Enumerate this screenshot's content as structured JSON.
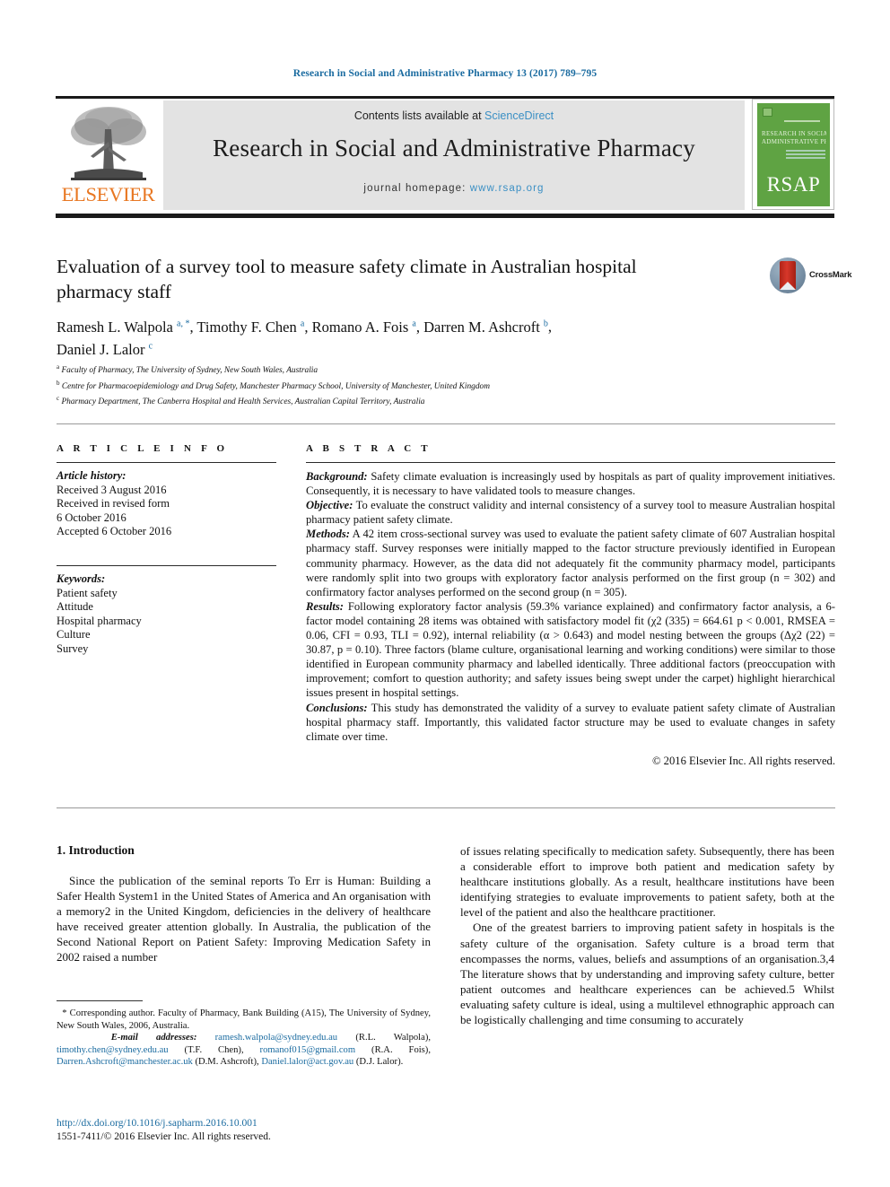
{
  "running_head": "Research in Social and Administrative Pharmacy 13 (2017) 789–795",
  "banner": {
    "contents_prefix": "Contents lists available at ",
    "sciencedirect": "ScienceDirect",
    "journal_title": "Research in Social and Administrative Pharmacy",
    "homepage_prefix": "journal homepage: ",
    "homepage_url": "www.rsap.org",
    "publisher": "ELSEVIER",
    "cover": {
      "line1": "RESEARCH IN SOCIAL &",
      "line2": "ADMINISTRATIVE PHARMACY",
      "acronym": "RSAP"
    },
    "colors": {
      "link": "#3a8fc4",
      "banner_bg": "#e3e3e3",
      "elsevier_orange": "#e87722",
      "cover_green": "#5fa343"
    }
  },
  "crossmark": {
    "label": "CrossMark"
  },
  "article": {
    "title": "Evaluation of a survey tool to measure safety climate in Australian hospital pharmacy staff",
    "authors_line1_parts": [
      {
        "name": "Ramesh L. Walpola ",
        "marks": "a, *"
      },
      {
        "name": ", Timothy F. Chen ",
        "marks": "a"
      },
      {
        "name": ", Romano A. Fois ",
        "marks": "a"
      },
      {
        "name": ", Darren M. Ashcroft ",
        "marks": "b"
      }
    ],
    "authors_line2": {
      "name": "Daniel J. Lalor ",
      "marks": "c"
    },
    "affiliations": [
      {
        "mark": "a",
        "text": "Faculty of Pharmacy, The University of Sydney, New South Wales, Australia"
      },
      {
        "mark": "b",
        "text": "Centre for Pharmacoepidemiology and Drug Safety, Manchester Pharmacy School, University of Manchester, United Kingdom"
      },
      {
        "mark": "c",
        "text": "Pharmacy Department, The Canberra Hospital and Health Services, Australian Capital Territory, Australia"
      }
    ]
  },
  "info": {
    "heading": "A R T I C L E  I N F O",
    "history_label": "Article history:",
    "history": [
      "Received 3 August 2016",
      "Received in revised form",
      "6 October 2016",
      "Accepted 6 October 2016"
    ],
    "keywords_label": "Keywords:",
    "keywords": [
      "Patient safety",
      "Attitude",
      "Hospital pharmacy",
      "Culture",
      "Survey"
    ]
  },
  "abstract": {
    "heading": "A B S T R A C T",
    "sections": [
      {
        "label": "Background:",
        "text": " Safety climate evaluation is increasingly used by hospitals as part of quality improvement initiatives. Consequently, it is necessary to have validated tools to measure changes."
      },
      {
        "label": "Objective:",
        "text": " To evaluate the construct validity and internal consistency of a survey tool to measure Australian hospital pharmacy patient safety climate."
      },
      {
        "label": "Methods:",
        "text": " A 42 item cross-sectional survey was used to evaluate the patient safety climate of 607 Australian hospital pharmacy staff. Survey responses were initially mapped to the factor structure previously identified in European community pharmacy. However, as the data did not adequately fit the community pharmacy model, participants were randomly split into two groups with exploratory factor analysis performed on the first group (n = 302) and confirmatory factor analyses performed on the second group (n = 305)."
      },
      {
        "label": "Results:",
        "text": " Following exploratory factor analysis (59.3% variance explained) and confirmatory factor analysis, a 6-factor model containing 28 items was obtained with satisfactory model fit (χ2 (335) = 664.61 p < 0.001, RMSEA = 0.06, CFI = 0.93, TLI = 0.92), internal reliability (α > 0.643) and model nesting between the groups (Δχ2 (22) = 30.87, p = 0.10). Three factors (blame culture, organisational learning and working conditions) were similar to those identified in European community pharmacy and labelled identically. Three additional factors (preoccupation with improvement; comfort to question authority; and safety issues being swept under the carpet) highlight hierarchical issues present in hospital settings."
      },
      {
        "label": "Conclusions:",
        "text": " This study has demonstrated the validity of a survey to evaluate patient safety climate of Australian hospital pharmacy staff. Importantly, this validated factor structure may be used to evaluate changes in safety climate over time."
      }
    ],
    "copyright": "© 2016 Elsevier Inc. All rights reserved."
  },
  "body": {
    "section_heading": "1. Introduction",
    "left_paragraph_1": "Since the publication of the seminal reports To Err is Human: Building a Safer Health System1 in the United States of America and An organisation with a memory2 in the United Kingdom, deficiencies in the delivery of healthcare have received greater attention globally. In Australia, the publication of the Second National Report on Patient Safety: Improving Medication Safety in 2002 raised a number",
    "right_paragraph_1": "of issues relating specifically to medication safety. Subsequently, there has been a considerable effort to improve both patient and medication safety by healthcare institutions globally. As a result, healthcare institutions have been identifying strategies to evaluate improvements to patient safety, both at the level of the patient and also the healthcare practitioner.",
    "right_paragraph_2": "One of the greatest barriers to improving patient safety in hospitals is the safety culture of the organisation. Safety culture is a broad term that encompasses the norms, values, beliefs and assumptions of an organisation.3,4 The literature shows that by understanding and improving safety culture, better patient outcomes and healthcare experiences can be achieved.5 Whilst evaluating safety culture is ideal, using a multilevel ethnographic approach can be logistically challenging and time consuming to accurately"
  },
  "footnotes": {
    "corresponding_marker": "*",
    "corresponding": " Corresponding author. Faculty of Pharmacy, Bank Building (A15), The University of Sydney, New South Wales, 2006, Australia.",
    "email_label": "E-mail addresses:",
    "emails": [
      {
        "address": "ramesh.walpola@sydney.edu.au",
        "who": " (R.L. Walpola), "
      },
      {
        "address": "timothy.chen@sydney.edu.au",
        "who": " (T.F. Chen), "
      },
      {
        "address": "romanof015@gmail.com",
        "who": " (R.A. Fois), "
      },
      {
        "address": "Darren.Ashcroft@manchester.ac.uk",
        "who": " (D.M. Ashcroft), "
      },
      {
        "address": "Daniel.lalor@act.gov.au",
        "who": " (D.J. Lalor)."
      }
    ],
    "doi": "http://dx.doi.org/10.1016/j.sapharm.2016.10.001",
    "issn": "1551-7411/© 2016 Elsevier Inc. All rights reserved."
  }
}
